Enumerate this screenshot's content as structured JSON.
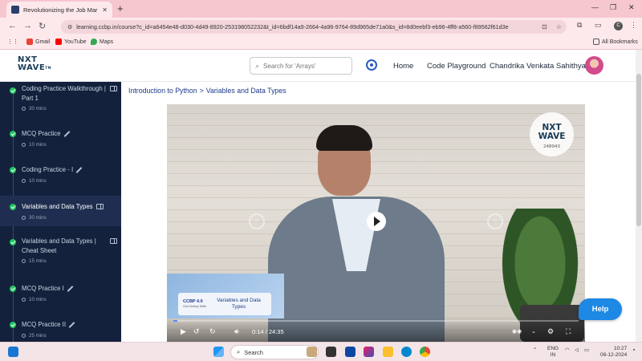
{
  "browser": {
    "tab_title": "Revolutionizing the Job Market",
    "url": "learning.ccbp.in/course?c_id=a6454e48-d030-4d49-8920-253198052232&t_id=6bdf14a9-2664-4a96-9764-89d965de71a0&s_id=8d0eebf3-eb96-4ff8-a560-f89562f61d3e",
    "profile_initial": "C",
    "bookmarks": [
      "Gmail",
      "YouTube",
      "Maps"
    ],
    "all_bookmarks": "All Bookmarks"
  },
  "header": {
    "logo_line1": "NXT",
    "logo_line2": "WAVE",
    "logo_tm": "TM",
    "search_placeholder": "Search for 'Arrays'",
    "nav": [
      "Home",
      "Code Playground"
    ],
    "user_name": "Chandrika Venkata Sahithya"
  },
  "sidebar": {
    "items": [
      {
        "title": "Coding Practice Walkthrough | Part 1",
        "duration": "30 mins",
        "icon": "book-icon"
      },
      {
        "title": "MCQ Practice",
        "duration": "10 mins",
        "icon": "pencil-icon"
      },
      {
        "title": "Coding Practice - I",
        "duration": "10 mins",
        "icon": "pencil-icon"
      },
      {
        "title": "Variables and Data Types",
        "duration": "30 mins",
        "icon": "book-icon",
        "active": true
      },
      {
        "title": "Variables and Data Types | Cheat Sheet",
        "duration": "15 mins",
        "icon": "book-icon"
      },
      {
        "title": "MCQ Practice I",
        "duration": "10 mins",
        "icon": "pencil-icon"
      },
      {
        "title": "MCQ Practice II",
        "duration": "25 mins",
        "icon": "pencil-icon"
      }
    ]
  },
  "main": {
    "breadcrumb": [
      "Introduction to Python",
      "Variables and Data Types"
    ],
    "breadcrumb_sep": ">",
    "video": {
      "badge_line1": "NXT",
      "badge_line2": "WAVE",
      "badge_id": "248943",
      "card_logo": "CCBP 4.0",
      "card_logo_sub": "21st Century Skills",
      "card_title": "Variables and Data Types",
      "current_time": "0:14",
      "duration": "24:35",
      "progress": 0.0095
    },
    "help_label": "Help"
  },
  "taskbar": {
    "search_label": "Search",
    "lang_line1": "ENG",
    "lang_line2": "IN",
    "time": "10:27",
    "date": "08-12-2024"
  },
  "colors": {
    "sidebar_bg": "#14213d",
    "accent": "#1e88e5",
    "check_green": "#22c55e",
    "tab_bar": "#f6c7cf"
  }
}
